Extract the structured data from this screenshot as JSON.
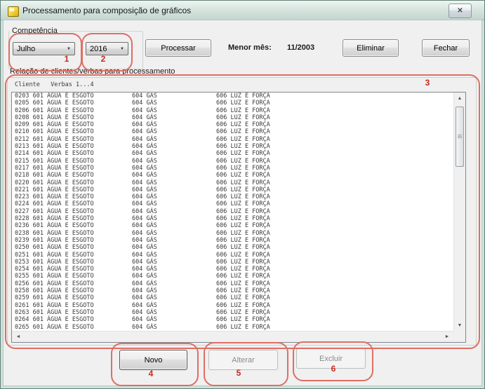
{
  "window": {
    "title": "Processamento para composição de gráficos"
  },
  "icons": {
    "close": "✕",
    "combo_arrow": "▼",
    "scroll_up": "▲",
    "scroll_down": "▼",
    "scroll_left": "◄",
    "scroll_right": "►"
  },
  "competencia": {
    "label": "Competência",
    "month": "Julho",
    "year": "2016"
  },
  "toolbar": {
    "processar": "Processar",
    "menor_mes_label": "Menor mês:",
    "menor_mes_value": "11/2003",
    "eliminar": "Eliminar",
    "fechar": "Fechar"
  },
  "section": {
    "label": "Relação de clientes/verbas para processamento"
  },
  "listbox": {
    "header": "Cliente   Verbas 1...4",
    "verbas": [
      "601 ÁGUA E ESGOTO",
      "604 GÁS",
      "606 LUZ E FORÇA"
    ],
    "codes": [
      "0203",
      "0205",
      "0206",
      "0208",
      "0209",
      "0210",
      "0212",
      "0213",
      "0214",
      "0215",
      "0217",
      "0218",
      "0220",
      "0221",
      "0223",
      "0224",
      "0227",
      "0228",
      "0236",
      "0238",
      "0239",
      "0250",
      "0251",
      "0253",
      "0254",
      "0255",
      "0256",
      "0258",
      "0259",
      "0261",
      "0263",
      "0264",
      "0265"
    ]
  },
  "actions": {
    "novo": "Novo",
    "alterar": "Alterar",
    "excluir": "Excluir"
  },
  "annotations": {
    "n1": "1",
    "n2": "2",
    "n3": "3",
    "n4": "4",
    "n5": "5",
    "n6": "6"
  },
  "colors": {
    "annotation": "#dd6f63",
    "annotation_text": "#c22a1d",
    "titlebar_tint": "#d3e2dc",
    "dialog_bg": "#f0f0f0"
  }
}
